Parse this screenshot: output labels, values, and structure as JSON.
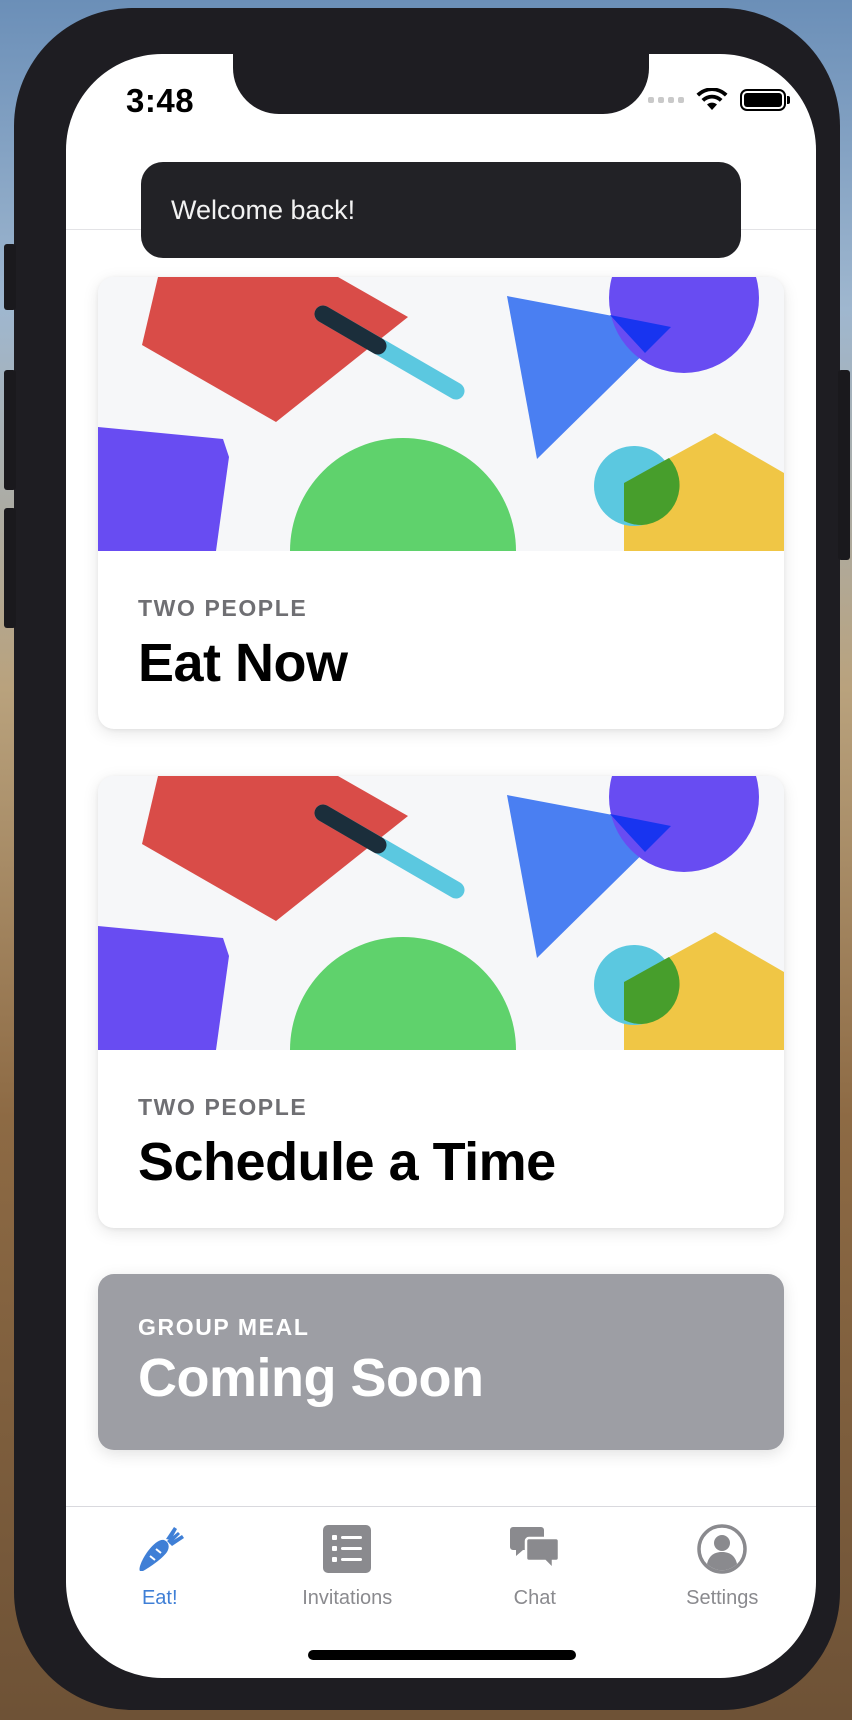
{
  "status_bar": {
    "time": "3:48"
  },
  "toast": {
    "message": "Welcome back!"
  },
  "cards": [
    {
      "eyebrow": "TWO PEOPLE",
      "title": "Eat Now"
    },
    {
      "eyebrow": "TWO PEOPLE",
      "title": "Schedule a Time"
    },
    {
      "eyebrow": "GROUP MEAL",
      "title": "Coming Soon"
    }
  ],
  "tabbar": {
    "items": [
      {
        "label": "Eat!",
        "icon": "carrot-icon",
        "active": true
      },
      {
        "label": "Invitations",
        "icon": "list-icon",
        "active": false
      },
      {
        "label": "Chat",
        "icon": "chat-bubbles-icon",
        "active": false
      },
      {
        "label": "Settings",
        "icon": "user-circle-icon",
        "active": false
      }
    ]
  },
  "colors": {
    "accent": "#3f7fd6",
    "toast_bg": "#222226",
    "disabled_card": "#9d9ea4",
    "art_red": "#d94c48",
    "art_blue": "#4a7ff2",
    "art_purple": "#684cf2",
    "art_green": "#5fd26c",
    "art_cyan": "#5bc8e0",
    "art_yellow": "#f0c645"
  }
}
